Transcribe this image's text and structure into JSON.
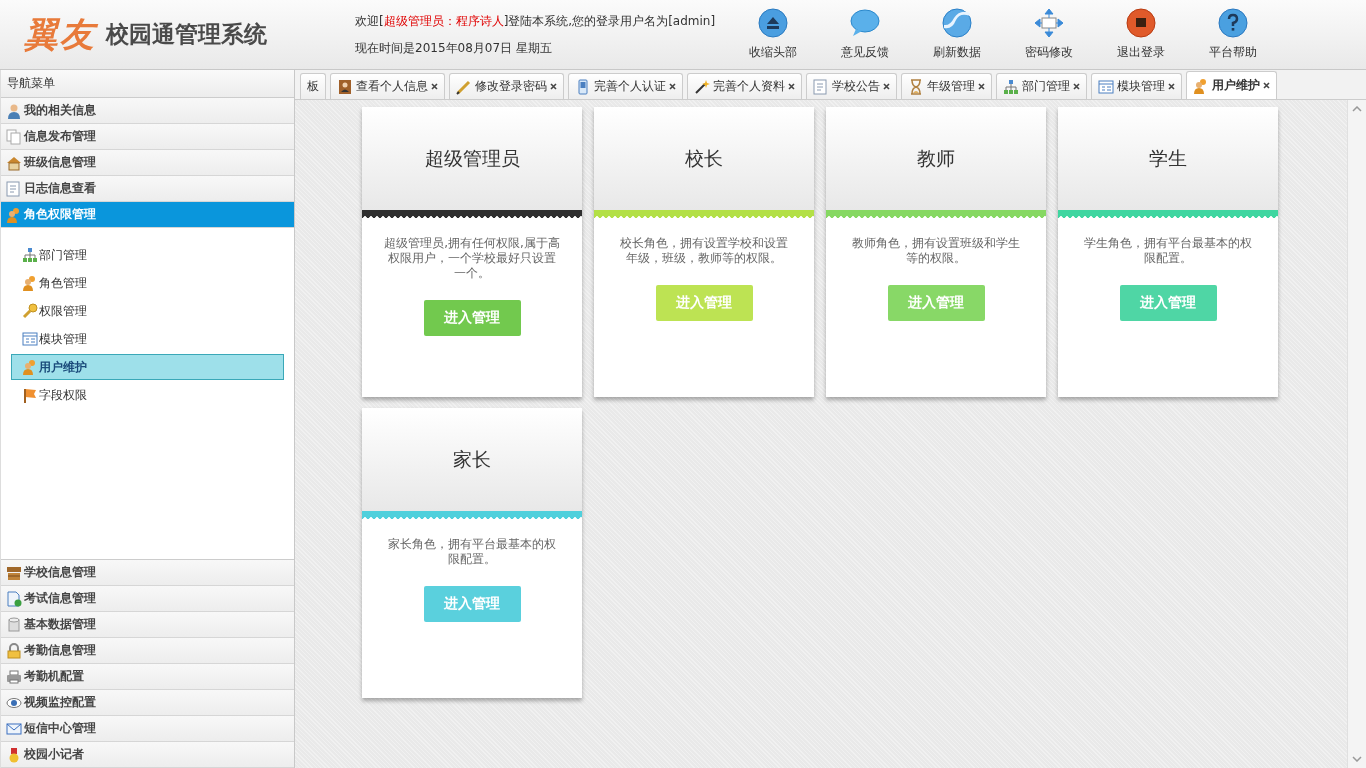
{
  "header": {
    "logo": "翼友",
    "title": "校园通管理系统",
    "welcome": {
      "before": "欢迎[",
      "highlight": "超级管理员：程序诗人",
      "after": "]登陆本系统,您的登录用户名为[admin]"
    },
    "datetime": "现在时间是2015年08月07日 星期五"
  },
  "toolbar": [
    {
      "label": "收缩头部"
    },
    {
      "label": "意见反馈"
    },
    {
      "label": "刷新数据"
    },
    {
      "label": "密码修改"
    },
    {
      "label": "退出登录"
    },
    {
      "label": "平台帮助"
    }
  ],
  "sidebar": {
    "title": "导航菜单",
    "sections": [
      {
        "label": "我的相关信息",
        "selected": false
      },
      {
        "label": "信息发布管理",
        "selected": false
      },
      {
        "label": "班级信息管理",
        "selected": false
      },
      {
        "label": "日志信息查看",
        "selected": false
      },
      {
        "label": "角色权限管理",
        "selected": true,
        "children": [
          {
            "label": "部门管理",
            "selected": false
          },
          {
            "label": "角色管理",
            "selected": false
          },
          {
            "label": "权限管理",
            "selected": false
          },
          {
            "label": "模块管理",
            "selected": false
          },
          {
            "label": "用户维护",
            "selected": true
          },
          {
            "label": "字段权限",
            "selected": false
          }
        ]
      },
      {
        "label": "学校信息管理",
        "selected": false
      },
      {
        "label": "考试信息管理",
        "selected": false
      },
      {
        "label": "基本数据管理",
        "selected": false
      },
      {
        "label": "考勤信息管理",
        "selected": false
      },
      {
        "label": "考勤机配置",
        "selected": false
      },
      {
        "label": "视频监控配置",
        "selected": false
      },
      {
        "label": "短信中心管理",
        "selected": false
      },
      {
        "label": "校园小记者",
        "selected": false
      }
    ]
  },
  "tabs": [
    {
      "label": "板",
      "selected": false,
      "closable": false
    },
    {
      "label": "查看个人信息",
      "selected": false,
      "closable": true
    },
    {
      "label": "修改登录密码",
      "selected": false,
      "closable": true
    },
    {
      "label": "完善个人认证",
      "selected": false,
      "closable": true
    },
    {
      "label": "完善个人资料",
      "selected": false,
      "closable": true
    },
    {
      "label": "学校公告",
      "selected": false,
      "closable": true
    },
    {
      "label": "年级管理",
      "selected": false,
      "closable": true
    },
    {
      "label": "部门管理",
      "selected": false,
      "closable": true
    },
    {
      "label": "模块管理",
      "selected": false,
      "closable": true
    },
    {
      "label": "用户维护",
      "selected": true,
      "closable": true
    }
  ],
  "cards": [
    {
      "title": "超级管理员",
      "description": "超级管理员,拥有任何权限,属于高权限用户，一个学校最好只设置一个。",
      "button": {
        "label": "进入管理",
        "color": "#72c94e"
      },
      "color": "#2f2f2f"
    },
    {
      "title": "校长",
      "description": "校长角色，拥有设置学校和设置年级，班级，教师等的权限。",
      "button": {
        "label": "进入管理",
        "color": "#bde353"
      },
      "color": "#b3e046"
    },
    {
      "title": "教师",
      "description": "教师角色，拥有设置班级和学生等的权限。",
      "button": {
        "label": "进入管理",
        "color": "#88d867"
      },
      "color": "#86d862"
    },
    {
      "title": "学生",
      "description": "学生角色，拥有平台最基本的权限配置。",
      "button": {
        "label": "进入管理",
        "color": "#4fd6a5"
      },
      "color": "#3fd6a0"
    },
    {
      "title": "家长",
      "description": "家长角色，拥有平台最基本的权限配置。",
      "button": {
        "label": "进入管理",
        "color": "#5ad0dd"
      },
      "color": "#4fd0dc"
    }
  ]
}
